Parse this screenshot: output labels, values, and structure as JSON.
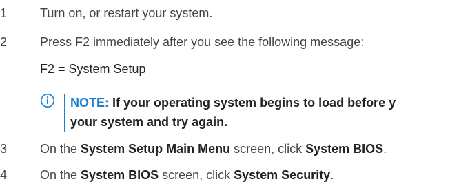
{
  "steps": [
    {
      "number": "1",
      "text": "Turn on, or restart your system."
    },
    {
      "number": "2",
      "text": "Press F2 immediately after you see the following message:"
    },
    {
      "number": "3",
      "parts": [
        "On the ",
        "System Setup Main Menu",
        " screen, click ",
        "System BIOS",
        "."
      ]
    },
    {
      "number": "4",
      "parts": [
        "On the ",
        "System BIOS",
        " screen, click ",
        "System Security",
        "."
      ]
    }
  ],
  "message": "F2 = System Setup",
  "note": {
    "label": "NOTE:",
    "line1": "If your operating system begins to load before y",
    "line2": "your system and try again."
  },
  "colors": {
    "accent": "#1b7fd0",
    "body_text": "#444444",
    "strong_text": "#222222"
  },
  "icons": {
    "note": "info-circle-icon"
  }
}
